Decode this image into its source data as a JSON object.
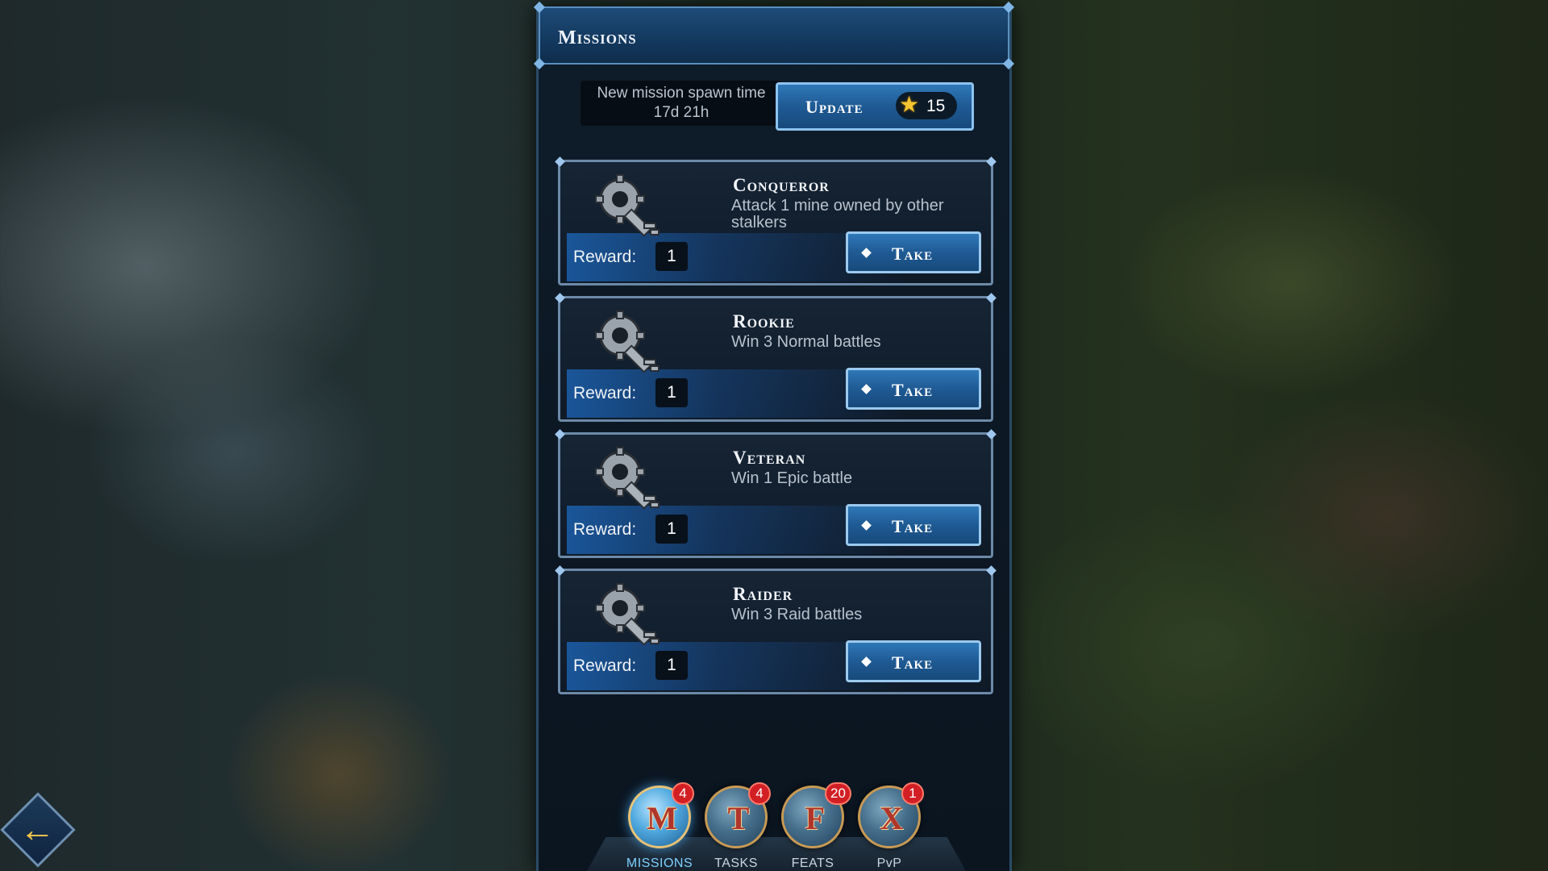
{
  "panel": {
    "title": "Missions",
    "spawn_label": "New mission spawn time",
    "spawn_time": "17d 21h",
    "update_label": "Update",
    "update_cost": "15",
    "update_cost_icon": "star-icon"
  },
  "missions": [
    {
      "name": "Conqueror",
      "description": "Attack 1 mine owned by other stalkers",
      "reward_label": "Reward:",
      "reward_value": "1",
      "button_label": "Take",
      "icon": "key-icon"
    },
    {
      "name": "Rookie",
      "description": "Win 3 Normal battles",
      "reward_label": "Reward:",
      "reward_value": "1",
      "button_label": "Take",
      "icon": "key-icon"
    },
    {
      "name": "Veteran",
      "description": "Win 1 Epic battle",
      "reward_label": "Reward:",
      "reward_value": "1",
      "button_label": "Take",
      "icon": "key-icon"
    },
    {
      "name": "Raider",
      "description": "Win 3 Raid battles",
      "reward_label": "Reward:",
      "reward_value": "1",
      "button_label": "Take",
      "icon": "key-icon"
    }
  ],
  "nav": {
    "items": [
      {
        "label": "MISSIONS",
        "letter": "M",
        "badge": "4",
        "active": true
      },
      {
        "label": "TASKS",
        "letter": "T",
        "badge": "4",
        "active": false
      },
      {
        "label": "FEATS",
        "letter": "F",
        "badge": "20",
        "active": false
      },
      {
        "label": "PvP",
        "letter": "X",
        "badge": "1",
        "active": false
      }
    ]
  },
  "back_button": {
    "icon": "arrow-left-icon"
  },
  "colors": {
    "accent_blue": "#1f5a94",
    "badge_red": "#d21f24",
    "star_gold": "#f4c431",
    "active_label": "#7fd0ff"
  }
}
